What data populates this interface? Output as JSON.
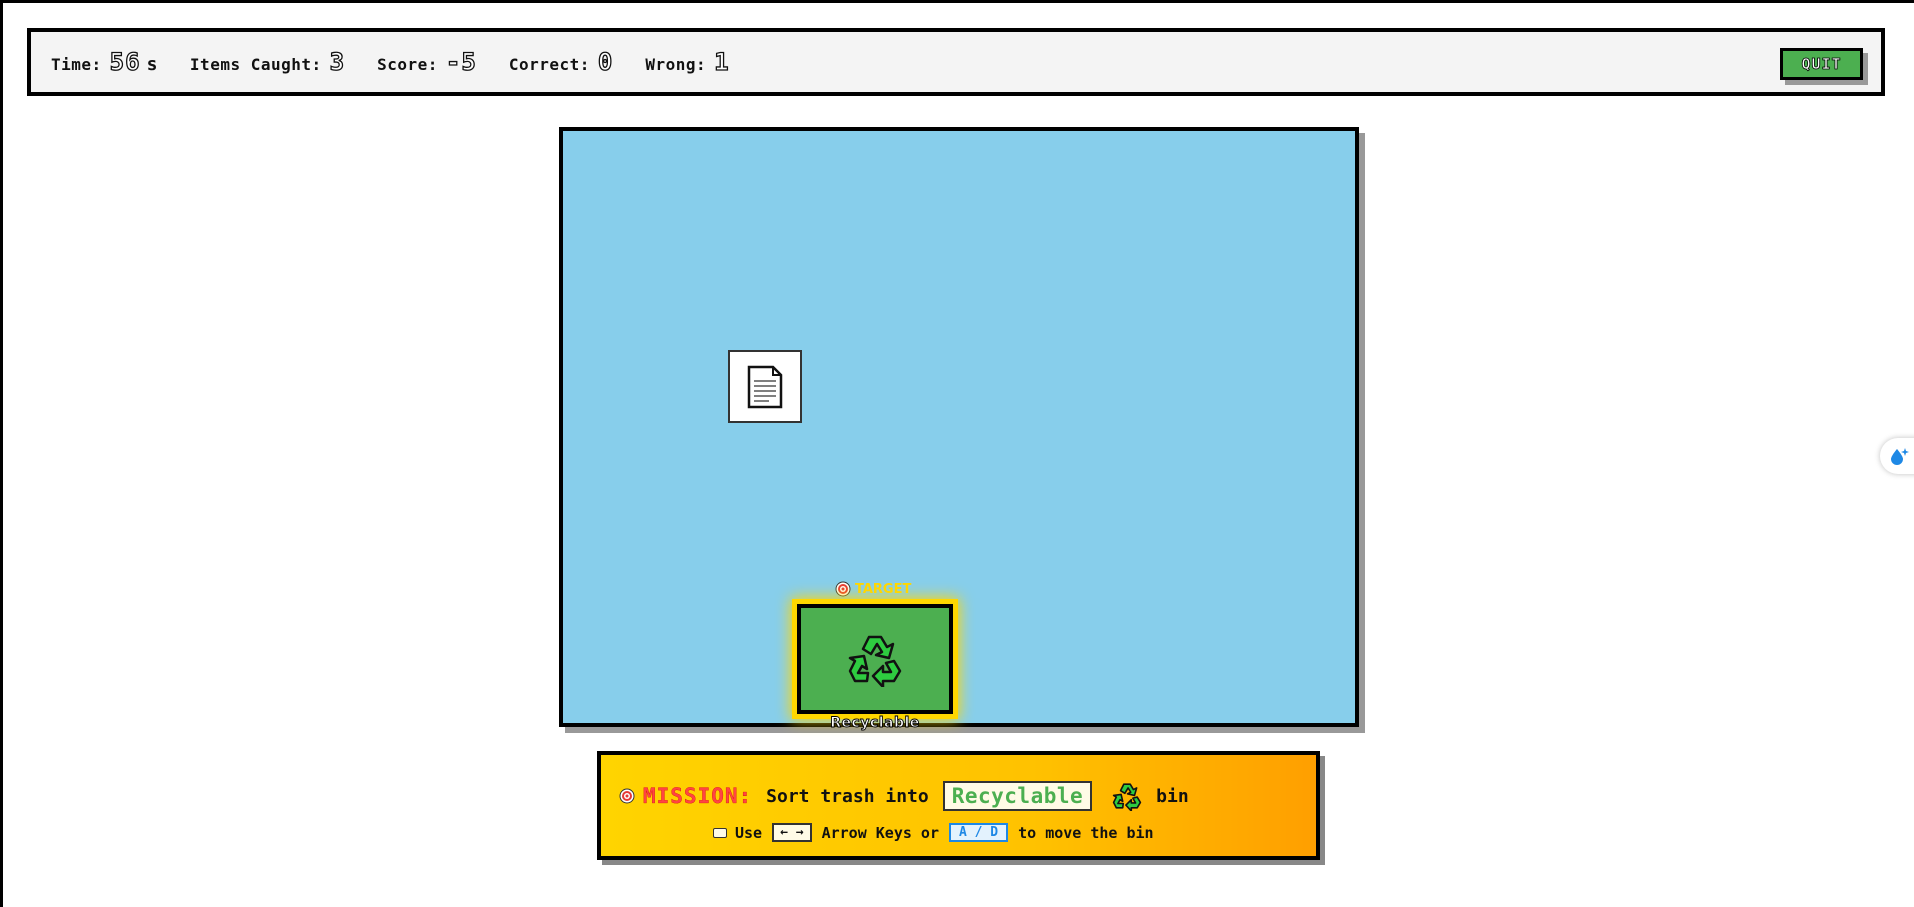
{
  "hud": {
    "time_label": "Time:",
    "time_value": "56",
    "time_unit": "s",
    "items_label": "Items Caught:",
    "items_value": "3",
    "score_label": "Score:",
    "score_value": "-5",
    "correct_label": "Correct:",
    "correct_value": "0",
    "wrong_label": "Wrong:",
    "wrong_value": "1",
    "quit_label": "QUIT"
  },
  "game": {
    "falling_item_icon": "document-icon",
    "target_text": "TARGET",
    "bin_icon": "recycle-icon",
    "bin_label": "Recyclable"
  },
  "mission": {
    "title": "MISSION:",
    "text_before": "Sort trash into",
    "category": "Recyclable",
    "text_after": "bin",
    "use_text": "Use",
    "arrow_keys_box": "← →",
    "arrow_keys_text": "Arrow Keys or",
    "ad_keys": "A / D",
    "move_text": "to move the bin"
  },
  "colors": {
    "sky": "#87ceeb",
    "bin_green": "#4caf50",
    "glow": "#ffd700",
    "mission_red": "#ff4444"
  }
}
